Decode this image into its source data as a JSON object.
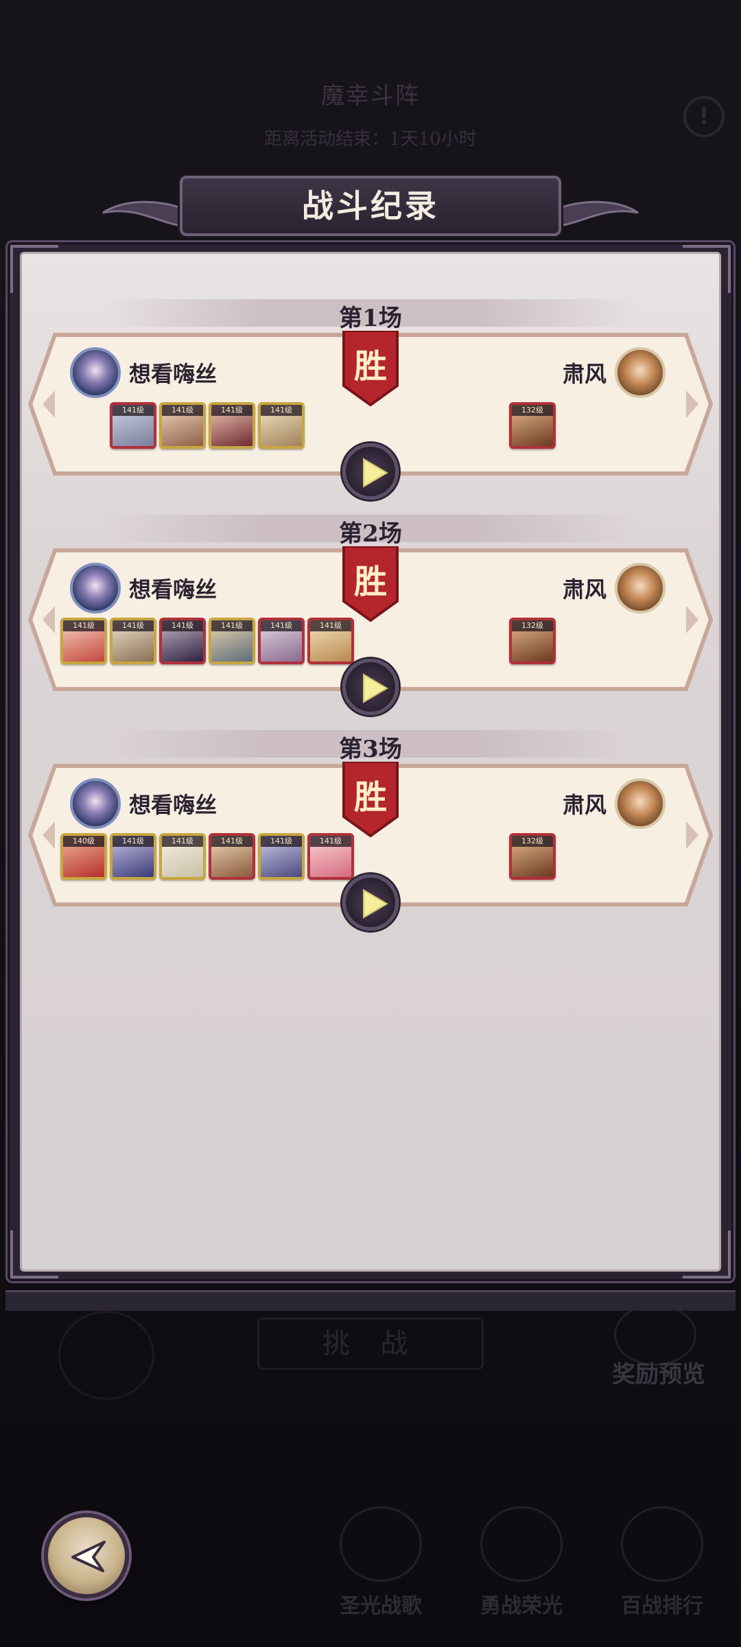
{
  "background": {
    "event_title": "魔幸斗阵",
    "timer": "距离活动结束：1天10小时",
    "challenge_label": "挑 战",
    "reward_preview": "奖励预览",
    "tabs": [
      {
        "label": "圣光战歌",
        "icon": "holy-song-icon"
      },
      {
        "label": "勇战荣光",
        "icon": "glory-icon"
      },
      {
        "label": "百战排行",
        "icon": "ranking-icon"
      }
    ]
  },
  "panel": {
    "title": "战斗纪录",
    "matches": [
      {
        "label": "第1场",
        "result": "胜",
        "left_player": {
          "name": "想看嗨丝",
          "avatar": "purple-hair-knight-avatar"
        },
        "right_player": {
          "name": "肃风",
          "avatar": "brown-hair-male-avatar"
        },
        "left_heroes": [
          "141级",
          "141级",
          "141级",
          "141级"
        ],
        "right_heroes": [
          "132级"
        ]
      },
      {
        "label": "第2场",
        "result": "胜",
        "left_player": {
          "name": "想看嗨丝",
          "avatar": "purple-hair-knight-avatar"
        },
        "right_player": {
          "name": "肃风",
          "avatar": "brown-hair-male-avatar"
        },
        "left_heroes": [
          "141级",
          "141级",
          "141级",
          "141级",
          "141级",
          "141级"
        ],
        "right_heroes": [
          "132级"
        ]
      },
      {
        "label": "第3场",
        "result": "胜",
        "left_player": {
          "name": "想看嗨丝",
          "avatar": "purple-hair-knight-avatar"
        },
        "right_player": {
          "name": "肃风",
          "avatar": "brown-hair-male-avatar"
        },
        "left_heroes": [
          "140级",
          "141级",
          "141级",
          "141级",
          "141级",
          "141级"
        ],
        "right_heroes": [
          "132级"
        ]
      }
    ]
  },
  "colors": {
    "win_badge": "#b5262c",
    "card_bg": "#f6efe2",
    "card_border": "#c8a79a",
    "panel_frame": "#2b2232"
  }
}
